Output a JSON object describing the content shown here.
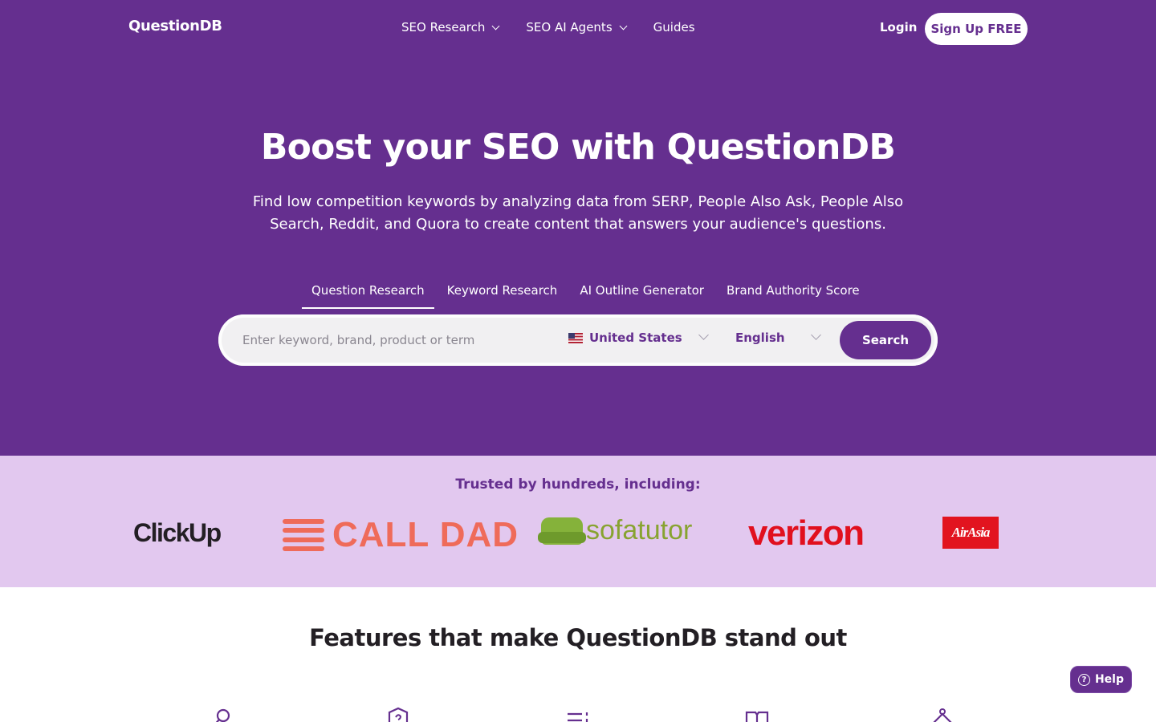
{
  "nav": {
    "logo": "QuestionDB",
    "links": [
      {
        "label": "SEO Research",
        "dropdown": true
      },
      {
        "label": "SEO AI Agents",
        "dropdown": true
      },
      {
        "label": "Guides",
        "dropdown": false
      }
    ],
    "login_label": "Login",
    "signup_label": "Sign Up FREE"
  },
  "hero": {
    "title": "Boost your SEO with QuestionDB",
    "subtitle": "Find low competition keywords by analyzing data from SERP, People Also Ask, People Also Search, Reddit, and Quora to create content that answers your audience's questions.",
    "tabs": [
      {
        "label": "Question Research",
        "active": true
      },
      {
        "label": "Keyword Research",
        "active": false
      },
      {
        "label": "AI Outline Generator",
        "active": false
      },
      {
        "label": "Brand Authority Score",
        "active": false
      }
    ]
  },
  "search": {
    "placeholder": "Enter keyword, brand, product or term",
    "value": "",
    "country": "United States",
    "country_icon": "us-flag-icon",
    "language": "English",
    "button_label": "Search"
  },
  "trusted": {
    "title": "Trusted by hundreds, including:",
    "logos": [
      "ClickUp",
      "CALL DAD",
      "sofatutor",
      "verizon",
      "AirAsia"
    ]
  },
  "features": {
    "title": "Features that make QuestionDB stand out",
    "icons": [
      "key-icon",
      "image-question-icon",
      "list-icon",
      "book-icon",
      "hanger-icon"
    ]
  },
  "help": {
    "label": "Help"
  },
  "colors": {
    "brand_purple": "#652f8f",
    "trusted_bg": "#e2c8ef",
    "white": "#ffffff"
  }
}
